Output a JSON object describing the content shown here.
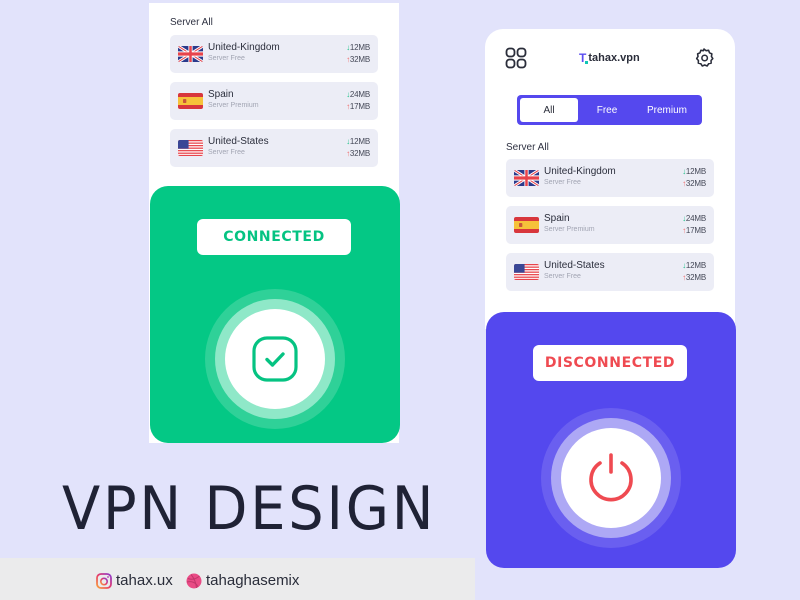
{
  "colors": {
    "background": "#e2e3fb",
    "connected_green": "#04c885",
    "disconnected_purple": "#5448ee",
    "disconnected_red": "#ef4a51",
    "download_green": "#22c28a",
    "upload_red": "#f06b6b"
  },
  "left_phone": {
    "section_title": "Server All",
    "servers": [
      {
        "name": "United-Kingdom",
        "tier": "Server Free",
        "flag": "uk-flag-icon",
        "down": "12MB",
        "up": "32MB"
      },
      {
        "name": "Spain",
        "tier": "Server Premium",
        "flag": "spain-flag-icon",
        "down": "24MB",
        "up": "17MB"
      },
      {
        "name": "United-States",
        "tier": "Server Free",
        "flag": "us-flag-icon",
        "down": "12MB",
        "up": "32MB"
      }
    ],
    "status": "CONNECTED",
    "status_icon": "check-square-icon"
  },
  "right_phone": {
    "header": {
      "menu_icon": "grid-icon",
      "brand_logo": "T",
      "brand_name": "tahax.vpn",
      "settings_icon": "gear-icon"
    },
    "tabs": [
      {
        "label": "All",
        "active": true
      },
      {
        "label": "Free",
        "active": false
      },
      {
        "label": "Premium",
        "active": false
      }
    ],
    "section_title": "Server All",
    "servers": [
      {
        "name": "United-Kingdom",
        "tier": "Server Free",
        "flag": "uk-flag-icon",
        "down": "12MB",
        "up": "32MB"
      },
      {
        "name": "Spain",
        "tier": "Server Premium",
        "flag": "spain-flag-icon",
        "down": "24MB",
        "up": "17MB"
      },
      {
        "name": "United-States",
        "tier": "Server Free",
        "flag": "us-flag-icon",
        "down": "12MB",
        "up": "32MB"
      }
    ],
    "status": "DISCONNECTED",
    "status_icon": "power-icon"
  },
  "title": "VPN DESIGN",
  "footer": {
    "instagram_handle": "tahax.ux",
    "dribbble_handle": "tahaghasemix"
  },
  "arrows": {
    "down": "↓",
    "up": "↑"
  }
}
